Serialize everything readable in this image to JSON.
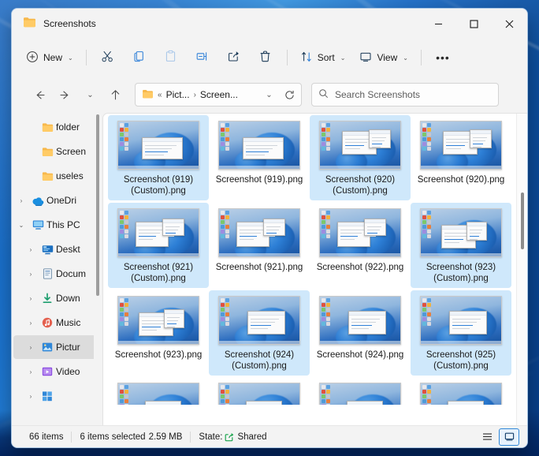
{
  "window": {
    "title": "Screenshots",
    "title_icon": "folder-icon",
    "controls": {
      "minimize": "–",
      "maximize": "□",
      "close": "✕"
    }
  },
  "toolbar": {
    "new_label": "New",
    "new_icon": "plus-circle-icon",
    "items": [
      {
        "name": "cut",
        "icon": "scissors-icon",
        "enabled": true
      },
      {
        "name": "copy",
        "icon": "copy-icon",
        "enabled": true
      },
      {
        "name": "paste",
        "icon": "paste-icon",
        "enabled": false
      },
      {
        "name": "rename",
        "icon": "rename-icon",
        "enabled": true
      },
      {
        "name": "share",
        "icon": "share-icon",
        "enabled": true
      },
      {
        "name": "delete",
        "icon": "trash-icon",
        "enabled": true
      }
    ],
    "sort_label": "Sort",
    "sort_icon": "sort-arrows-icon",
    "view_label": "View",
    "view_icon": "monitor-icon",
    "more_label": "•••"
  },
  "address": {
    "back_icon": "arrow-left-icon",
    "forward_icon": "arrow-right-icon",
    "recent_icon": "chevron-down-icon",
    "up_icon": "arrow-up-icon",
    "folder_icon": "folder-icon",
    "overflow": "«",
    "crumbs": [
      "Pict...",
      "Screen..."
    ],
    "separator": "›",
    "dropdown_icon": "chevron-down-icon",
    "refresh_icon": "refresh-icon"
  },
  "search": {
    "icon": "search-icon",
    "placeholder": "Search Screenshots",
    "value": ""
  },
  "sidebar": {
    "items": [
      {
        "label": "folder",
        "icon": "folder-icon",
        "expander": "",
        "indent": 1,
        "selected": false
      },
      {
        "label": "Screen",
        "icon": "folder-icon",
        "expander": "",
        "indent": 1,
        "selected": false
      },
      {
        "label": "useles",
        "icon": "folder-icon",
        "expander": "",
        "indent": 1,
        "selected": false
      },
      {
        "label": "OneDri",
        "icon": "onedrive-icon",
        "expander": "›",
        "indent": 0,
        "selected": false
      },
      {
        "label": "This PC",
        "icon": "this-pc-icon",
        "expander": "⌄",
        "indent": 0,
        "selected": false
      },
      {
        "label": "Deskt",
        "icon": "desktop-icon",
        "expander": "›",
        "indent": 1,
        "selected": false
      },
      {
        "label": "Docum",
        "icon": "documents-icon",
        "expander": "›",
        "indent": 1,
        "selected": false
      },
      {
        "label": "Down",
        "icon": "downloads-icon",
        "expander": "›",
        "indent": 1,
        "selected": false
      },
      {
        "label": "Music",
        "icon": "music-icon",
        "expander": "›",
        "indent": 1,
        "selected": false
      },
      {
        "label": "Pictur",
        "icon": "pictures-icon",
        "expander": "›",
        "indent": 1,
        "selected": true
      },
      {
        "label": "Video",
        "icon": "videos-icon",
        "expander": "›",
        "indent": 1,
        "selected": false
      },
      {
        "label": "",
        "icon": "windows-drive-icon",
        "expander": "›",
        "indent": 1,
        "selected": false
      }
    ]
  },
  "files": [
    {
      "name": "Screenshot (919) (Custom).png",
      "selected": true,
      "variant": 1
    },
    {
      "name": "Screenshot (919).png",
      "selected": false,
      "variant": 1
    },
    {
      "name": "Screenshot (920) (Custom).png",
      "selected": true,
      "variant": 2
    },
    {
      "name": "Screenshot (920).png",
      "selected": false,
      "variant": 2
    },
    {
      "name": "Screenshot (921) (Custom).png",
      "selected": true,
      "variant": 3
    },
    {
      "name": "Screenshot (921).png",
      "selected": false,
      "variant": 3
    },
    {
      "name": "Screenshot (922).png",
      "selected": false,
      "variant": 3
    },
    {
      "name": "Screenshot (923) (Custom).png",
      "selected": true,
      "variant": 4
    },
    {
      "name": "Screenshot (923).png",
      "selected": false,
      "variant": 4
    },
    {
      "name": "Screenshot (924) (Custom).png",
      "selected": true,
      "variant": 5
    },
    {
      "name": "Screenshot (924).png",
      "selected": false,
      "variant": 5
    },
    {
      "name": "Screenshot (925) (Custom).png",
      "selected": true,
      "variant": 5
    },
    {
      "name": "",
      "selected": false,
      "variant": 6,
      "partial": true
    },
    {
      "name": "",
      "selected": false,
      "variant": 6,
      "partial": true
    },
    {
      "name": "",
      "selected": false,
      "variant": 6,
      "partial": true
    },
    {
      "name": "",
      "selected": false,
      "variant": 6,
      "partial": true
    }
  ],
  "status": {
    "item_count": "66 items",
    "selection": "6 items selected",
    "size": "2.59 MB",
    "state_label": "State:",
    "state_icon": "shared-arrow-icon",
    "state_value": "Shared",
    "views": [
      {
        "name": "details-view",
        "icon": "list-lines-icon",
        "active": false
      },
      {
        "name": "large-icons-view",
        "icon": "large-icon-tile-icon",
        "active": true
      }
    ]
  },
  "colors": {
    "accent": "#2f87d8",
    "selection": "#cfe8fb",
    "window_bg": "#f3f3f3",
    "content_bg": "#ffffff"
  }
}
